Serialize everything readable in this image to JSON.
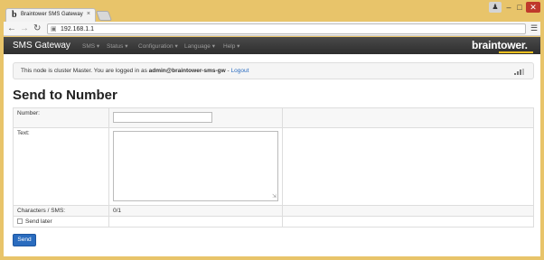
{
  "browser": {
    "tab_title": "Braintower SMS Gateway",
    "tab_favicon": "b",
    "tab_close": "×",
    "address": "192.168.1.1",
    "icons": {
      "back": "back-arrow-icon",
      "forward": "forward-arrow-icon",
      "reload": "reload-icon",
      "page": "page-icon",
      "menu": "hamburger-menu-icon"
    }
  },
  "navbar": {
    "brand": "SMS Gateway",
    "menus": [
      {
        "label": "SMS ▾"
      },
      {
        "label": "Status ▾"
      },
      {
        "label": "Configuration ▾"
      },
      {
        "label": "Language ▾"
      },
      {
        "label": "Help ▾"
      }
    ],
    "logo_text": "braintower."
  },
  "alert": {
    "prefix": "This node is cluster Master. You are logged in as ",
    "user": "admin@braintower-sms-gw",
    "separator": " - ",
    "logout": "Logout"
  },
  "page": {
    "title": "Send to Number"
  },
  "form": {
    "number_label": "Number:",
    "number_value": "",
    "text_label": "Text:",
    "text_value": "",
    "chars_label": "Characters / SMS:",
    "chars_value": "0/1",
    "send_later_label": "Send later",
    "send_button": "Send"
  },
  "colors": {
    "navbar": "#3a3a3a",
    "accent": "#2a6cbf",
    "logo_underline": "#f0c020"
  }
}
